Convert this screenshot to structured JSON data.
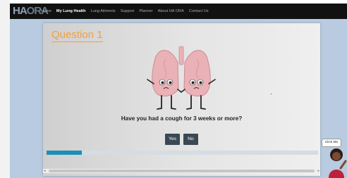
{
  "nav": {
    "brand_ha": "HA",
    "brand_ora": "ORA",
    "links": [
      "Home",
      "My Lung Health",
      "Lung Ailments",
      "Support",
      "Planner",
      "About HA ORA",
      "Contact Us"
    ]
  },
  "question": {
    "title": "Question 1",
    "text": "Have you had a cough for 3 weeks or more?",
    "yes_label": "Yes",
    "no_label": "No",
    "progress": 0.13
  },
  "help": {
    "label": "Click Me"
  },
  "colors": {
    "accent_orange": "#f0a040",
    "progress": "#1c8fb6",
    "button": "#3b4754",
    "navbar": "#111111",
    "page_bg": "#b8cbe0",
    "lung_pink": "#eab1b6"
  }
}
